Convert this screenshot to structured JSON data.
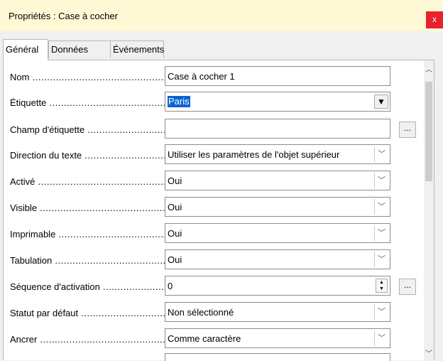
{
  "window": {
    "title": "Propriétés : Case à cocher",
    "close_label": "x"
  },
  "tabs": [
    {
      "label": "Général",
      "active": true
    },
    {
      "label": "Données",
      "active": false
    },
    {
      "label": "Événements",
      "active": false
    }
  ],
  "properties": [
    {
      "label": "Nom",
      "value": "Case à cocher 1",
      "control": "text"
    },
    {
      "label": "Étiquette",
      "value": "Paris",
      "control": "combo-selected"
    },
    {
      "label": "Champ d'étiquette",
      "value": "",
      "control": "text-ellipsis"
    },
    {
      "label": "Direction du texte",
      "value": "Utiliser les paramètres de l'objet supérieur",
      "control": "dropdown"
    },
    {
      "label": "Activé",
      "value": "Oui",
      "control": "dropdown"
    },
    {
      "label": "Visible",
      "value": "Oui",
      "control": "dropdown"
    },
    {
      "label": "Imprimable",
      "value": "Oui",
      "control": "dropdown"
    },
    {
      "label": "Tabulation",
      "value": "Oui",
      "control": "dropdown"
    },
    {
      "label": "Séquence d'activation",
      "value": "0",
      "control": "spin-ellipsis"
    },
    {
      "label": "Statut par défaut",
      "value": "Non sélectionné",
      "control": "dropdown"
    },
    {
      "label": "Ancrer",
      "value": "Comme caractère",
      "control": "dropdown"
    }
  ],
  "ellipsis_label": "...",
  "icons": {
    "dropdown": "chevron-down-icon",
    "scroll_up": "chevron-up-icon",
    "scroll_down": "chevron-down-icon"
  },
  "colors": {
    "titlebar": "#fff9d6",
    "close": "#e8212b",
    "selection": "#0a64d2"
  }
}
